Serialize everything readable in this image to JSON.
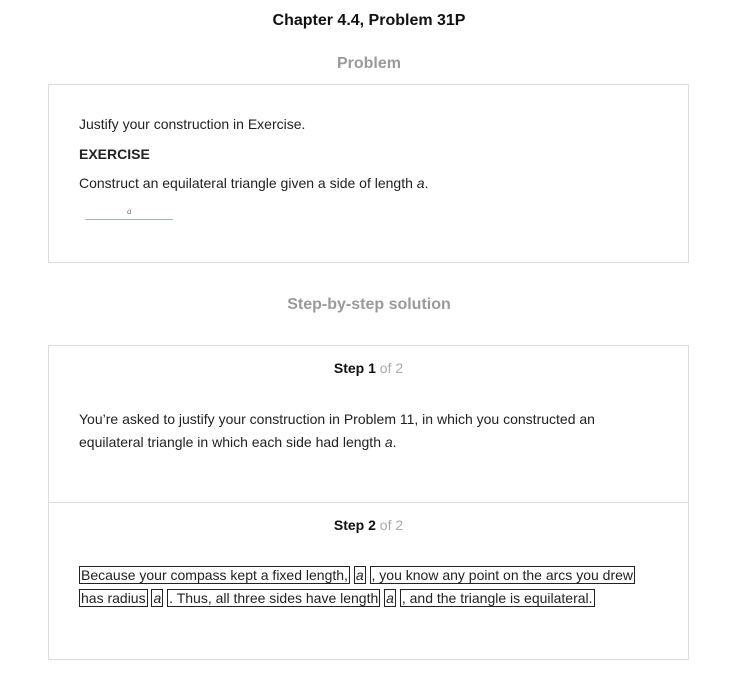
{
  "header": {
    "chapter_title": "Chapter 4.4, Problem 31P"
  },
  "problem": {
    "heading": "Problem",
    "intro": "Justify your construction in Exercise.",
    "exercise_label": "EXERCISE",
    "exercise_text_before": "Construct an equilateral triangle given a side of length ",
    "exercise_var": "a",
    "exercise_text_after": ".",
    "figure_label": "a"
  },
  "solution": {
    "heading": "Step-by-step solution",
    "steps": [
      {
        "word": "Step",
        "number": "1",
        "of": "of 2",
        "line1": "You’re asked to justify your construction in Problem 11, in which you constructed an",
        "line2_before": "equilateral triangle in which each side had length ",
        "line2_var": "a",
        "line2_after": "."
      },
      {
        "word": "Step",
        "number": "2",
        "of": "of 2",
        "part1": "Because your compass kept a fixed length,",
        "var1": "a",
        "part2": ", you know any point on the arcs you drew",
        "part3": "has radius",
        "var2": "a",
        "part4": ". Thus, all three sides have length",
        "var3": "a",
        "part5": ", and the triangle is equilateral."
      }
    ]
  }
}
